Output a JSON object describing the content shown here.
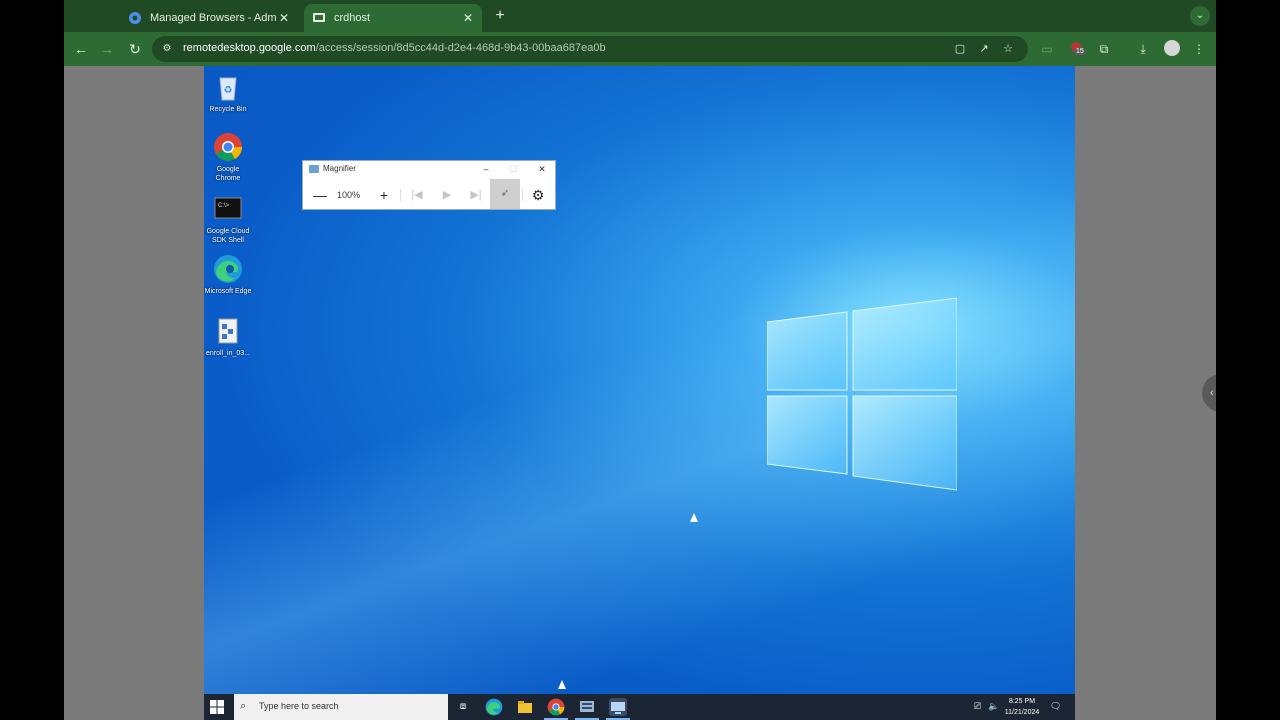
{
  "browser": {
    "tabs": [
      {
        "title": "Managed Browsers - Admin C",
        "close": "✕",
        "active": false
      },
      {
        "title": "crdhost",
        "close": "✕",
        "active": true
      }
    ],
    "new_tab": "+",
    "tab_menu": "⌄",
    "nav": {
      "back": "←",
      "forward": "→",
      "reload": "↻"
    },
    "url_host": "remotedesktop.google.com",
    "url_path": "/access/session/8d5cc44d-d2e4-468d-9b43-00baa687ea0b",
    "extension_badge": "15",
    "icons": [
      "site-info-icon",
      "bookmark-page-icon",
      "open-external-icon",
      "star-icon",
      "cast-icon",
      "extension-icon",
      "puzzle-icon",
      "download-icon",
      "avatar",
      "kebab-menu-icon"
    ]
  },
  "desktop": {
    "icons": [
      {
        "label": "Recycle Bin",
        "icon": "recycle-bin-icon"
      },
      {
        "label": "Google Chrome",
        "icon": "chrome-icon"
      },
      {
        "label": "Google Cloud SDK Shell",
        "icon": "terminal-icon"
      },
      {
        "label": "Microsoft Edge",
        "icon": "edge-icon"
      },
      {
        "label": "enroll_in_03...",
        "icon": "script-file-icon"
      }
    ],
    "magnifier": {
      "title": "Magnifier",
      "zoom": "100%",
      "minimize": "–",
      "maximize": "☐",
      "close": "✕",
      "zoom_out": "—",
      "zoom_in": "+",
      "prev": "|◀",
      "play": "▶",
      "next": "▶|",
      "settings": "⚙"
    },
    "taskbar": {
      "search_placeholder": "Type here to search",
      "time": "8:25 PM",
      "date": "11/21/2024",
      "apps": [
        "task-view-icon",
        "edge-icon",
        "file-explorer-icon",
        "chrome-icon",
        "server-manager-icon",
        "remote-desktop-icon"
      ]
    }
  },
  "colors": {
    "chrome_dark": "#1f4a24",
    "chrome_mid": "#2e6b34",
    "desktop_blue": "#0b57c4",
    "taskbar": "#1b2533"
  }
}
